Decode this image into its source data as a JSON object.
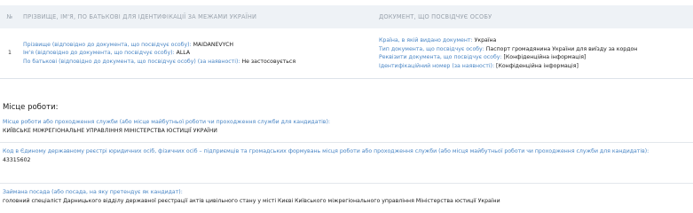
{
  "identity_table": {
    "headers": {
      "num": "№",
      "name": "ПРІЗВИЩЕ, ІМ'Я, ПО БАТЬКОВІ ДЛЯ ІДЕНТИФІКАЦІЇ ЗА МЕЖАМИ УКРАЇНИ",
      "document": "ДОКУМЕНТ, ЩО ПОСВІДЧУЄ ОСОБУ"
    },
    "row": {
      "num": "1",
      "surname_label": "Прізвище (відповідно до документа, що посвідчує особу):",
      "surname_value": "MAIDANEVYCH",
      "given_label": "Ім'я (відповідно до документа, що посвідчує особу):",
      "given_value": "ALLA",
      "patronymic_label": "По батькові (відповідно до документа, що посвідчує особу) (за наявності):",
      "patronymic_value": "Не застосовується",
      "country_label": "Країна, в якій видано документ:",
      "country_value": "Україна",
      "doctype_label": "Тип документа, що посвідчує особу:",
      "doctype_value": "Паспорт громадянина України для виїзду за кордон",
      "requisites_label": "Реквізити документа, що посвідчує особу:",
      "requisites_value": "[Конфіденційна інформація]",
      "idnum_label": "Ідентифікаційний номер (за наявності):",
      "idnum_value": "[Конфіденційна інформація]"
    }
  },
  "work": {
    "title": "Місце роботи:",
    "place_label": "Місце роботи або проходження служби (або місце майбутньої роботи чи проходження служби для кандидатів):",
    "place_value": "КИЇВСЬКЕ МІЖРЕГІОНАЛЬНЕ УПРАВЛІННЯ МІНІСТЕРСТВА ЮСТИЦІЇ УКРАЇНИ",
    "code_label": "Код в Єдиному державному реєстрі юридичних осіб, фізичних осіб – підприємців та громадських формувань місця роботи або проходження служби (або місця майбутньої роботи чи проходження служби для кандидатів):",
    "code_value": "43315602",
    "position_label": "Займана посада (або посада, на яку претендує як кандидат):",
    "position_value": "головний спеціаліст Дарницького відділу державної реєстрації актів цивільного стану у місті Києві Київського міжрегіонального управління Міністерства юстиції України"
  }
}
